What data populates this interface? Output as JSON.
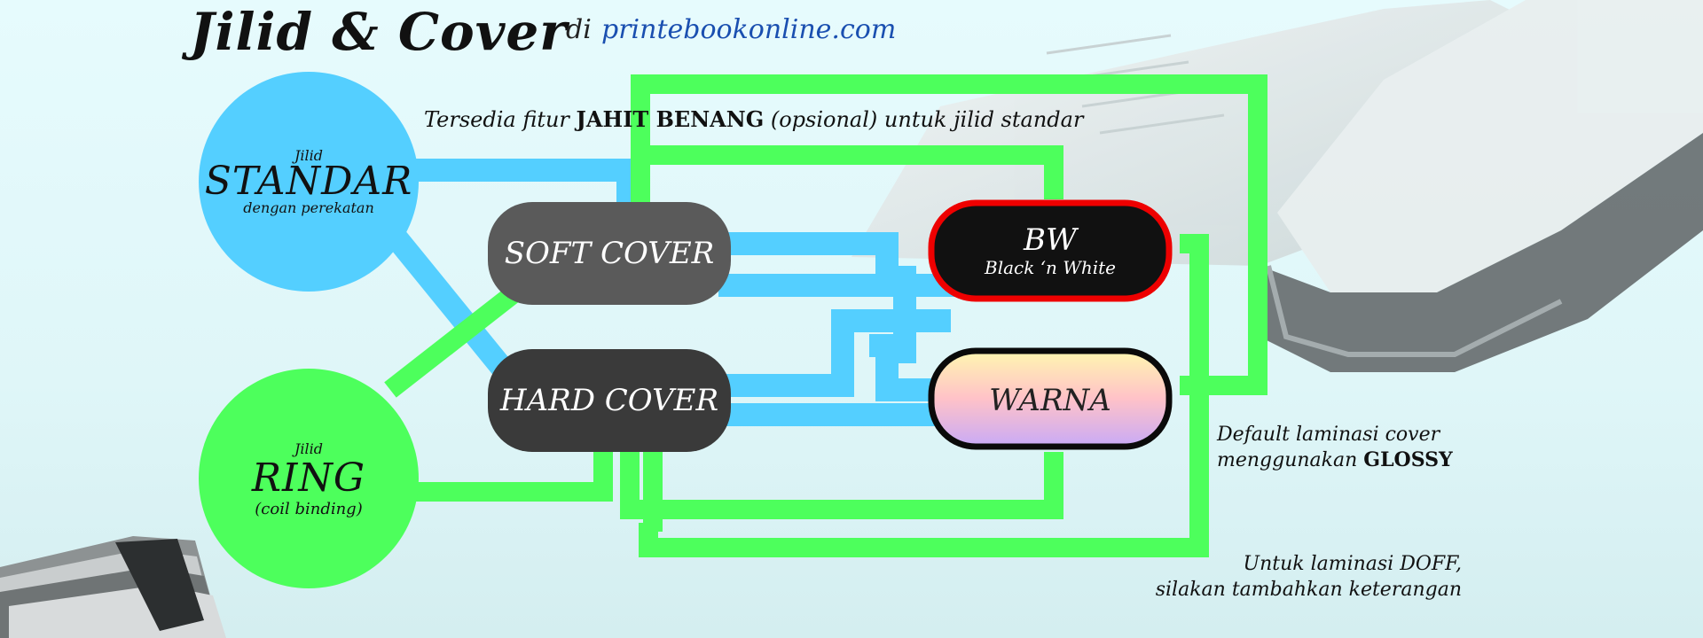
{
  "header": {
    "title": "Jilid & Cover",
    "di": "di",
    "site": "printebookonline.com"
  },
  "feature_note": {
    "prefix": "Tersedia fitur",
    "highlight": "JAHIT BENANG",
    "suffix": "(opsional) untuk jilid standar"
  },
  "bindings": {
    "standar": {
      "top": "Jilid",
      "main": "STANDAR",
      "sub": "dengan perekatan"
    },
    "ring": {
      "top": "Jilid",
      "main": "RING",
      "sub": "(coil binding)"
    }
  },
  "covers": {
    "soft": "SOFT COVER",
    "hard": "HARD COVER"
  },
  "print": {
    "bw": {
      "main": "BW",
      "sub": "Black ‘n White"
    },
    "warna": "WARNA"
  },
  "notes": {
    "default_line1": "Default laminasi cover",
    "default_line2_prefix": "menggunakan",
    "default_line2_bold": "GLOSSY",
    "doff_line1": "Untuk laminasi DOFF,",
    "doff_line2": "silakan tambahkan keterangan"
  },
  "colors": {
    "blue_path": "#54cfff",
    "green_path": "#4dff5c",
    "soft_pill": "#5a5a5a",
    "hard_pill": "#3a3a3a",
    "bw_pill": "#111111",
    "bw_border": "#ee0000",
    "site_link": "#1a4fb0"
  }
}
